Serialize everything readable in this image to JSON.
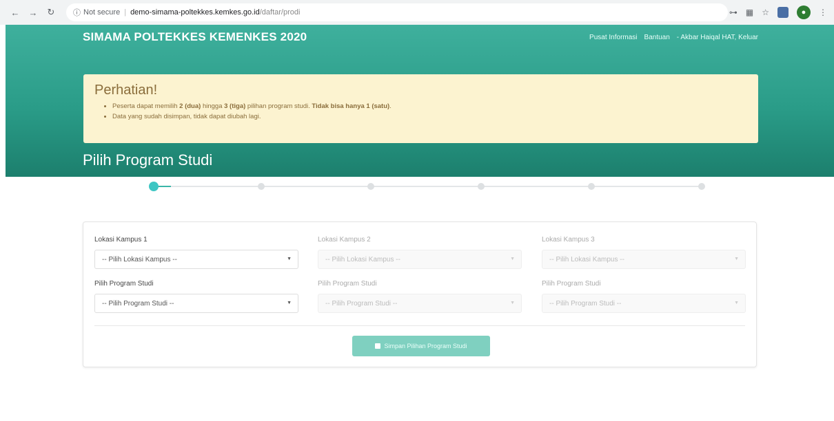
{
  "browser": {
    "security_label": "Not secure",
    "host": "demo-simama-poltekkes.kemkes.go.id",
    "path": "/daftar/prodi"
  },
  "header": {
    "brand": "SIMAMA POLTEKKES KEMENKES 2020",
    "nav": {
      "info": "Pusat Informasi",
      "help": "Bantuan",
      "user_logout": "- Akbar Haiqal HAT, Keluar"
    }
  },
  "alert": {
    "title": "Perhatian!",
    "item1": {
      "pre": "Peserta dapat memilih ",
      "b1": "2 (dua)",
      "mid1": " hingga ",
      "b2": "3 (tiga)",
      "mid2": " pilihan program studi. ",
      "b3": "Tidak bisa hanya 1 (satu)",
      "end": "."
    },
    "item2": "Data yang sudah disimpan, tidak dapat diubah lagi."
  },
  "page_title": "Pilih Program Studi",
  "stepper": {
    "total_steps": 6,
    "current_step": 1
  },
  "form": {
    "campus1_label": "Lokasi Kampus 1",
    "campus2_label": "Lokasi Kampus 2",
    "campus3_label": "Lokasi Kampus 3",
    "campus_placeholder": "-- Pilih Lokasi Kampus --",
    "prodi_label": "Pilih Program Studi",
    "prodi_placeholder": "-- Pilih Program Studi --",
    "submit_label": "Simpan Pilihan Program Studi"
  },
  "colors": {
    "header_teal": "#2a9c88",
    "alert_bg": "#fcf3d0",
    "step_active": "#3ec6c3",
    "button": "#7fd0c0"
  }
}
